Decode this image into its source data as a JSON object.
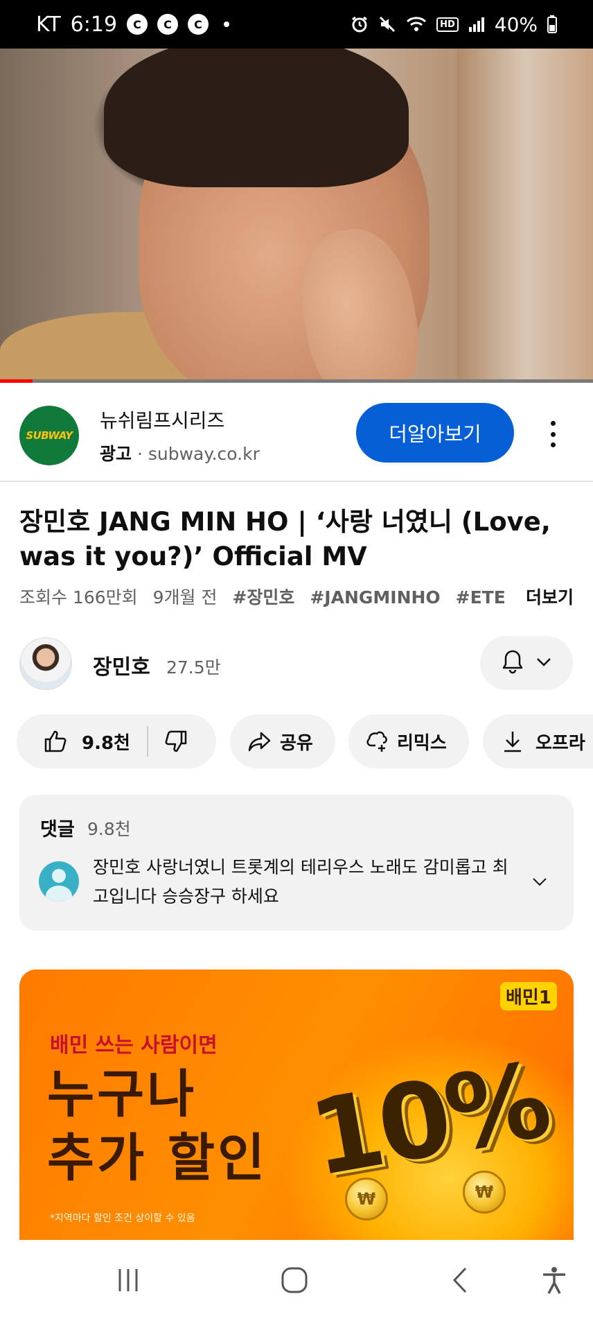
{
  "status_bar": {
    "carrier": "KT",
    "time": "6:19",
    "notif_icons": [
      "C",
      "C",
      "C"
    ],
    "hd_label": "HD",
    "battery": "40%"
  },
  "video": {
    "progress_fraction": 0.055
  },
  "ad": {
    "logo_text": "SUBWAY",
    "title": "뉴쉬림프시리즈",
    "label": "광고",
    "separator": " · ",
    "domain": "subway.co.kr",
    "cta_label": "더알아보기"
  },
  "video_info": {
    "title": "장민호 JANG MIN HO | ‘사랑 너였니 (Love, was it you?)’ Official MV",
    "views": "조회수 166만회",
    "age": "9개월 전",
    "tags": [
      "#장민호",
      "#JANGMINHO",
      "#ETE"
    ],
    "more_label": "더보기"
  },
  "channel": {
    "name": "장민호",
    "subscribers": "27.5만"
  },
  "actions": {
    "like_count": "9.8천",
    "share_label": "공유",
    "remix_label": "리믹스",
    "download_label": "오프라"
  },
  "comments": {
    "label": "댓글",
    "count": "9.8천",
    "top_comment": "장민호 사랑너였니 트롯계의 테리우스 노래도 감미롭고 최고입니다 승승장구 하세요"
  },
  "banner": {
    "brand": "배민1",
    "line1": "배민 쓰는 사람이면",
    "line2a": "누구나",
    "line2b": "추가 할인",
    "percent": "10%",
    "coin_symbol": "₩",
    "note": "*지역마다 할인 조건 상이할 수 있음"
  },
  "colors": {
    "accent_blue": "#065fd4",
    "progress_red": "#ff0000",
    "banner_orange": "#ff8000"
  }
}
